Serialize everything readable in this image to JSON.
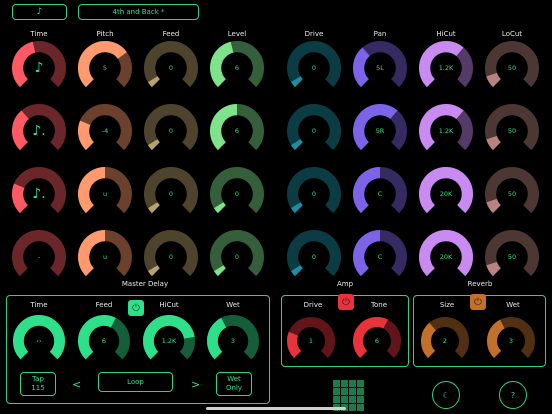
{
  "header": {
    "note_icon": "eighth-note-icon",
    "preset_name": "4th and Back *"
  },
  "columns": [
    "Time",
    "Pitch",
    "Feed",
    "Level",
    "Drive",
    "Pan",
    "HiCut",
    "LoCut"
  ],
  "colors": {
    "Time": "#ff5a63",
    "Pitch": "#ff9a6e",
    "Feed": "#b9a36b",
    "Level": "#7ee38a",
    "Drive": "#1b8ea3",
    "Pan": "#7d63e8",
    "HiCut": "#c98bf2",
    "LoCut": "#b8837e",
    "accent": "#2fe08a"
  },
  "rows": [
    {
      "Time": "♪",
      "Pitch": "5",
      "Feed": "0",
      "Level": "6",
      "Drive": "0",
      "Pan": "5L",
      "HiCut": "1.2K",
      "LoCut": "50"
    },
    {
      "Time": "♪.",
      "Pitch": "-4",
      "Feed": "0",
      "Level": "6",
      "Drive": "0",
      "Pan": "5R",
      "HiCut": "1.2K",
      "LoCut": "50"
    },
    {
      "Time": "♪.",
      "Pitch": "u",
      "Feed": "0",
      "Level": "0",
      "Drive": "0",
      "Pan": "C",
      "HiCut": "20K",
      "LoCut": "50"
    },
    {
      "Time": "-",
      "Pitch": "u",
      "Feed": "0",
      "Level": "0",
      "Drive": "0",
      "Pan": "C",
      "HiCut": "20K",
      "LoCut": "50"
    }
  ],
  "levels": [
    [
      0.45,
      0.7,
      0.05,
      0.45,
      0.05,
      0.35,
      0.65,
      0.1
    ],
    [
      0.35,
      0.25,
      0.05,
      0.5,
      0.05,
      0.65,
      0.65,
      0.1
    ],
    [
      0.25,
      0.5,
      0.05,
      0.05,
      0.05,
      0.5,
      1.0,
      0.1
    ],
    [
      0.0,
      0.5,
      0.05,
      0.05,
      0.05,
      0.5,
      1.0,
      0.1
    ]
  ],
  "master_delay": {
    "title": "Master Delay",
    "labels": [
      "Time",
      "Feed",
      "HiCut",
      "Wet"
    ],
    "values": [
      "‹›",
      "6",
      "1.2K",
      "3"
    ],
    "levels": [
      1.0,
      0.6,
      0.8,
      0.4
    ],
    "tap_label": "Tap",
    "tap_value": "115",
    "mode": "Loop",
    "wet_only": "Wet Only",
    "prev": "<",
    "next": ">"
  },
  "amp": {
    "title": "Amp",
    "labels": [
      "Drive",
      "Tone"
    ],
    "values": [
      "1",
      "6"
    ],
    "levels": [
      0.25,
      0.6
    ],
    "color": "#e8333b"
  },
  "reverb": {
    "title": "Reverb",
    "labels": [
      "Size",
      "Wet"
    ],
    "values": [
      "2",
      "3"
    ],
    "levels": [
      0.35,
      0.4
    ],
    "color": "#c2702a"
  },
  "footer": {
    "moon_icon": "☾",
    "help": "?"
  }
}
